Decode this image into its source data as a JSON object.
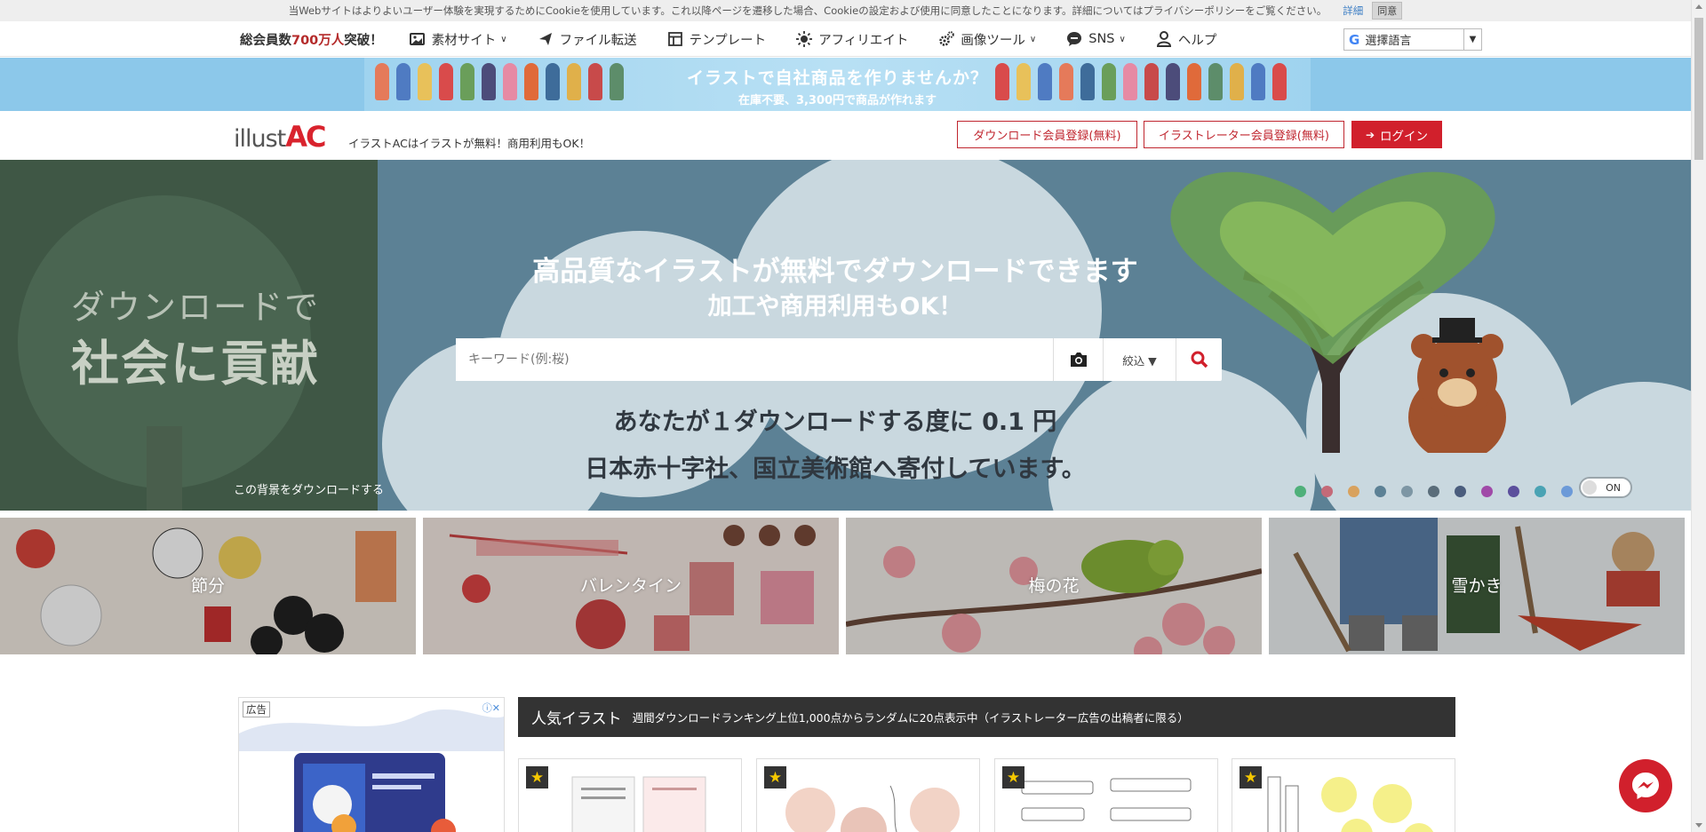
{
  "cookie": {
    "text": "当Webサイトはよりよいユーザー体験を実現するためにCookieを使用しています。これ以降ページを遷移した場合、Cookieの設定および使用に同意したことになります。詳細についてはプライバシーポリシーをご覧ください。",
    "detail_label": "詳細",
    "agree_label": "同意"
  },
  "nav": {
    "member_prefix": "総会員数",
    "member_highlight": "700万人",
    "member_suffix": "突破！",
    "items": [
      {
        "label": "素材サイト",
        "icon": "image-icon",
        "has_dropdown": true
      },
      {
        "label": "ファイル転送",
        "icon": "paper-plane-icon",
        "has_dropdown": false
      },
      {
        "label": "テンプレート",
        "icon": "template-icon",
        "has_dropdown": false
      },
      {
        "label": "アフィリエイト",
        "icon": "sun-icon",
        "has_dropdown": false
      },
      {
        "label": "画像ツール",
        "icon": "gears-icon",
        "has_dropdown": true
      },
      {
        "label": "SNS",
        "icon": "chat-bubble-icon",
        "has_dropdown": true
      },
      {
        "label": "ヘルプ",
        "icon": "user-help-icon",
        "has_dropdown": false
      }
    ],
    "translate_label": "選擇語言",
    "translate_g": "G"
  },
  "ad_banner": {
    "line1": "イラストで自社商品を作りませんか？",
    "line2": "在庫不要、3,300円で商品が作れます"
  },
  "header": {
    "logo_text": "illust",
    "logo_ac": "AC",
    "tagline": "イラストACはイラストが無料！商用利用もOK！",
    "register_download": "ダウンロード会員登録(無料)",
    "register_illustrator": "イラストレーター会員登録(無料)",
    "login": "ログイン"
  },
  "hero": {
    "left_line1": "ダウンロードで",
    "left_line2": "社会に貢献",
    "title1": "高品質なイラストが無料でダウンロードできます",
    "title2": "加工や商用利用もOK！",
    "search_placeholder": "キーワード(例:桜)",
    "filter_label": "絞込 ▼",
    "donate1": "あなたが１ダウンロードする度に 0.1 円",
    "donate2": "日本赤十字社、国立美術館へ寄付しています。",
    "bg_download": "この背景をダウンロードする",
    "toggle_label": "ON",
    "dot_colors": [
      "#4fb07a",
      "#c46a78",
      "#d8a25e",
      "#5c8195",
      "#7d96a4",
      "#5a6d7a",
      "#4a5d7d",
      "#a04aa8",
      "#5b4f9c",
      "#4aa3b4",
      "#6c9ad8"
    ]
  },
  "categories": [
    {
      "label": "節分"
    },
    {
      "label": "バレンタイン"
    },
    {
      "label": "梅の花"
    },
    {
      "label": "雪かき"
    }
  ],
  "popular": {
    "ad_tag": "広告",
    "title": "人気イラスト",
    "subtitle": "週間ダウンロードランキング上位1,000点からランダムに20点表示中（イラストレーター広告の出稿者に限る）"
  },
  "colors": {
    "brand_red": "#d1202c",
    "hero_bg": "#5c8195",
    "hero_left_bg": "#3f5745"
  }
}
